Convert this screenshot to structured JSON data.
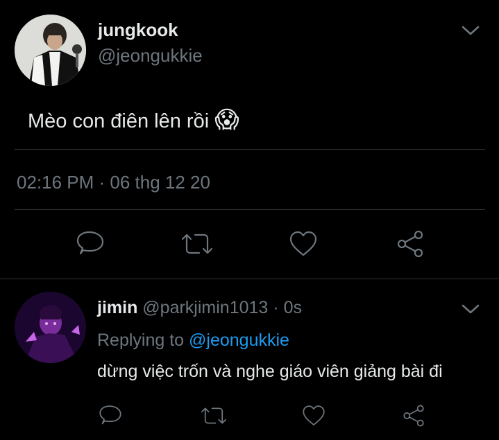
{
  "main_tweet": {
    "author_name": "jungkook",
    "author_handle": "@jeongukkie",
    "text": "Mèo con điên lên rồi",
    "emoji": "😱",
    "timestamp": "02:16 PM · 06 thg 12 20",
    "avatar_icon": "avatar-jungkook",
    "menu_icon": "chevron-down-icon",
    "actions": [
      "reply-icon",
      "retweet-icon",
      "like-icon",
      "share-icon"
    ]
  },
  "reply_tweet": {
    "author_name": "jimin",
    "author_handle": "@parkjimin1013",
    "time_sep": "·",
    "time": "0s",
    "replying_prefix": "Replying to",
    "replying_handle": "@jeongukkie",
    "text": "dừng việc trốn và nghe giáo viên giảng bài đi",
    "avatar_icon": "avatar-jimin",
    "menu_icon": "chevron-down-icon",
    "actions": [
      "reply-icon",
      "retweet-icon",
      "like-icon",
      "share-icon"
    ]
  },
  "colors": {
    "background": "#000000",
    "primary_text": "#e7e9ea",
    "secondary_text": "#6e767d",
    "accent": "#1d9bf0",
    "divider": "#2f3336"
  }
}
